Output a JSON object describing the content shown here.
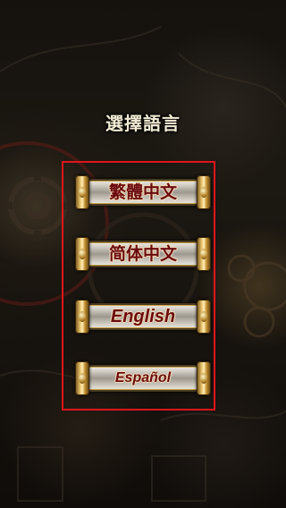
{
  "screen": {
    "title": "選擇語言"
  },
  "languages": [
    {
      "id": "zh-hant",
      "label": "繁體中文"
    },
    {
      "id": "zh-hans",
      "label": "简体中文"
    },
    {
      "id": "en",
      "label": "English"
    },
    {
      "id": "es",
      "label": "Español"
    }
  ],
  "colors": {
    "panel_border": "#e0141c",
    "button_text": "#6a0a10",
    "title_text": "#f3ecd6",
    "gold_accent": "#c9a44a"
  }
}
